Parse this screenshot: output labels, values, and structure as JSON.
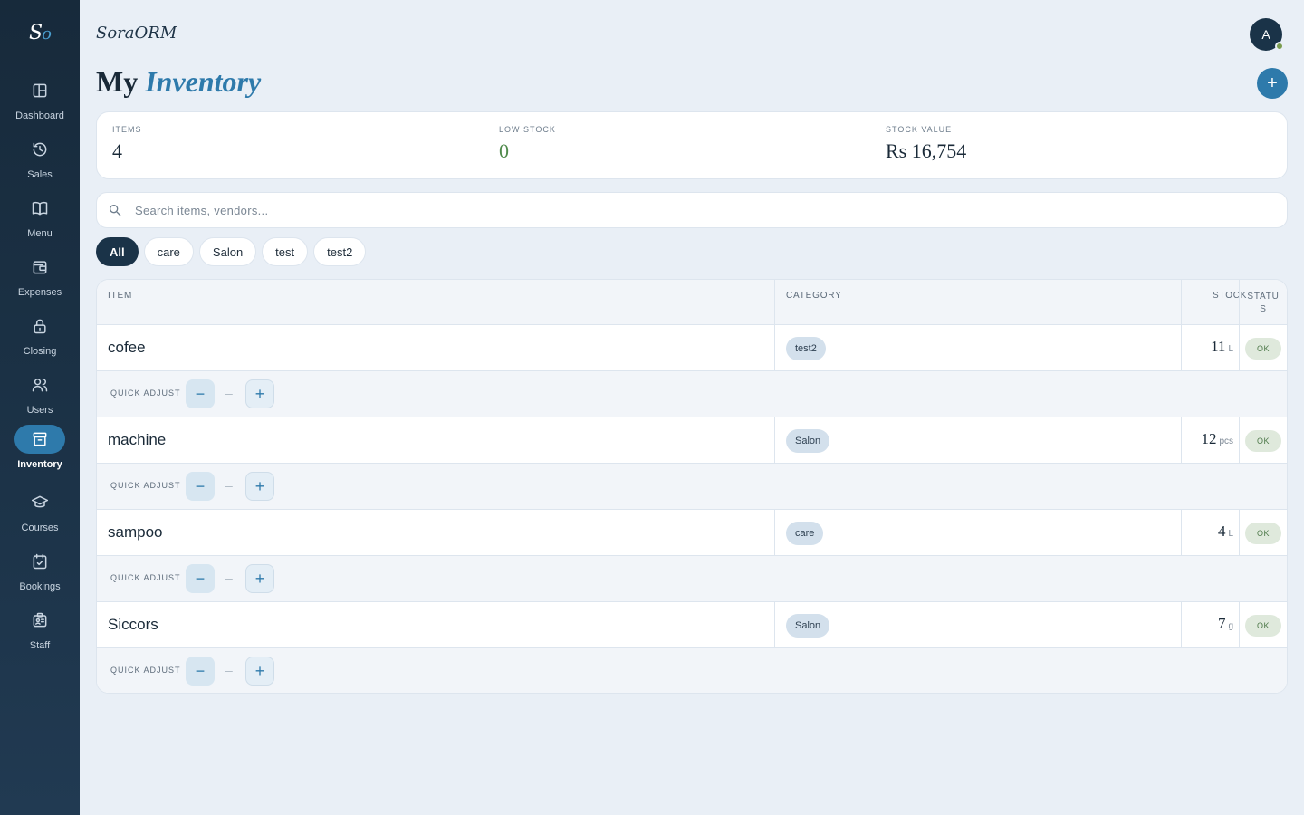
{
  "sidebar": {
    "logo_main": "S",
    "logo_accent": "o",
    "items": [
      {
        "label": "Dashboard",
        "icon": "dashboard-icon",
        "active": false
      },
      {
        "label": "Sales",
        "icon": "history-icon",
        "active": false
      },
      {
        "label": "Menu",
        "icon": "book-icon",
        "active": false
      },
      {
        "label": "Expenses",
        "icon": "wallet-icon",
        "active": false
      },
      {
        "label": "Closing",
        "icon": "lock-icon",
        "active": false
      },
      {
        "label": "Users",
        "icon": "users-icon",
        "active": false
      },
      {
        "label": "Inventory",
        "icon": "archive-icon",
        "active": true
      },
      {
        "label": "Courses",
        "icon": "graduation-cap-icon",
        "active": false
      },
      {
        "label": "Bookings",
        "icon": "calendar-check-icon",
        "active": false
      },
      {
        "label": "Staff",
        "icon": "id-card-icon",
        "active": false
      }
    ]
  },
  "header": {
    "brand": "SoraORM",
    "avatar_initial": "A",
    "title_plain": "My",
    "title_accent": "Inventory",
    "add_label": "+"
  },
  "stats": {
    "items": {
      "label": "ITEMS",
      "value": "4"
    },
    "low_stock": {
      "label": "LOW STOCK",
      "value": "0"
    },
    "stock_value": {
      "label": "STOCK VALUE",
      "value": "Rs 16,754"
    }
  },
  "search": {
    "placeholder": "Search items, vendors...",
    "value": ""
  },
  "filters": [
    "All",
    "care",
    "Salon",
    "test",
    "test2"
  ],
  "active_filter": "All",
  "table": {
    "headers": {
      "item": "ITEM",
      "category": "CATEGORY",
      "stock": "STOCK",
      "status": "STATU S"
    },
    "quick_adjust_label": "QUICK ADJUST",
    "minus": "−",
    "plus": "+",
    "dash": "–",
    "rows": [
      {
        "name": "cofee",
        "category": "test2",
        "stock": "11",
        "unit": "L",
        "status": "OK"
      },
      {
        "name": "machine",
        "category": "Salon",
        "stock": "12",
        "unit": "pcs",
        "status": "OK"
      },
      {
        "name": "sampoo",
        "category": "care",
        "stock": "4",
        "unit": "L",
        "status": "OK"
      },
      {
        "name": "Siccors",
        "category": "Salon",
        "stock": "7",
        "unit": "g",
        "status": "OK"
      }
    ]
  },
  "colors": {
    "sidebar_bg": "#1a3045",
    "accent": "#2e7aab",
    "ok_green": "#4f7a4b",
    "background": "#e9eff6"
  }
}
